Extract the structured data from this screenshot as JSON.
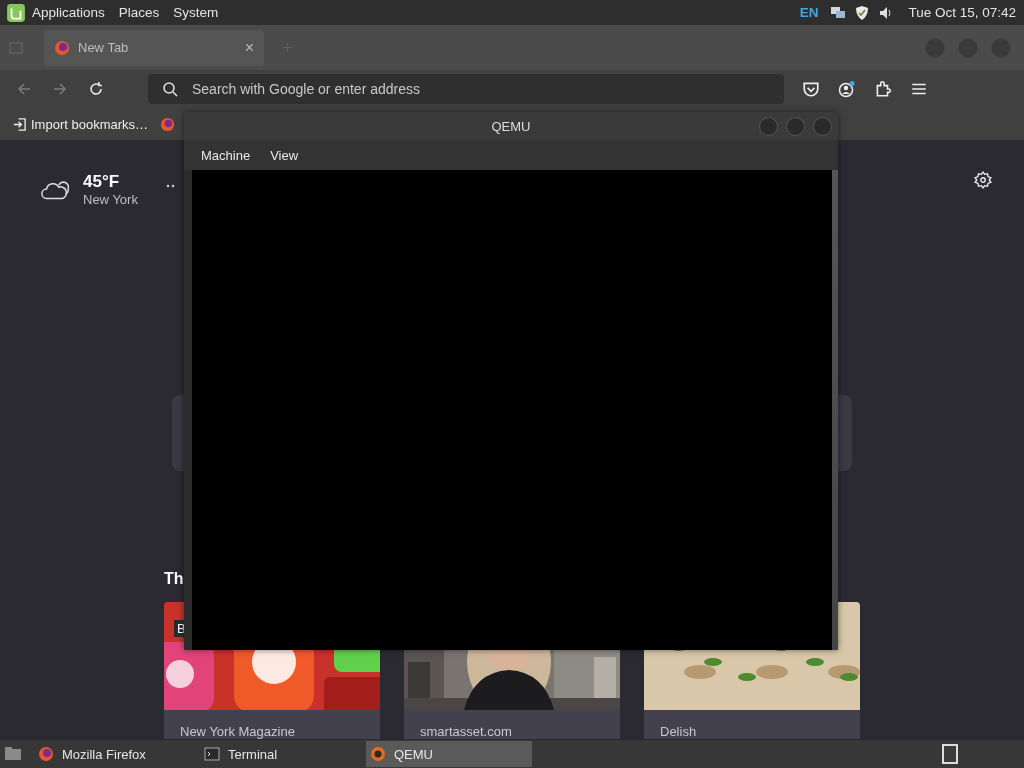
{
  "top_panel": {
    "menus": [
      "Applications",
      "Places",
      "System"
    ],
    "keyboard_layout": "EN",
    "clock": "Tue Oct 15, 07:42"
  },
  "browser": {
    "tabs": [
      {
        "label": "New Tab",
        "close": "×",
        "selected": true
      }
    ],
    "navigation": {
      "back_disabled": true,
      "forward_disabled": true
    },
    "address_bar": {
      "placeholder": "Search with Google or enter address"
    },
    "bookmarks": [
      {
        "label": "Import bookmarks…",
        "kind": "import"
      },
      {
        "kind": "firefox"
      }
    ],
    "new_tab_page": {
      "weather": {
        "temperature": "45°F",
        "location": "New York"
      },
      "section_heading": "Th",
      "cards": [
        {
          "source": "New York Magazine",
          "badge": "B"
        },
        {
          "source": "smartasset.com"
        },
        {
          "source": "Delish"
        }
      ]
    }
  },
  "qemu_window": {
    "title": "QEMU",
    "menus": [
      "Machine",
      "View"
    ]
  },
  "taskbar": {
    "tasks": [
      {
        "label": "Mozilla Firefox",
        "kind": "firefox",
        "selected": false
      },
      {
        "label": "Terminal",
        "kind": "terminal",
        "selected": false
      },
      {
        "label": "QEMU",
        "kind": "qemu",
        "selected": true
      }
    ]
  }
}
